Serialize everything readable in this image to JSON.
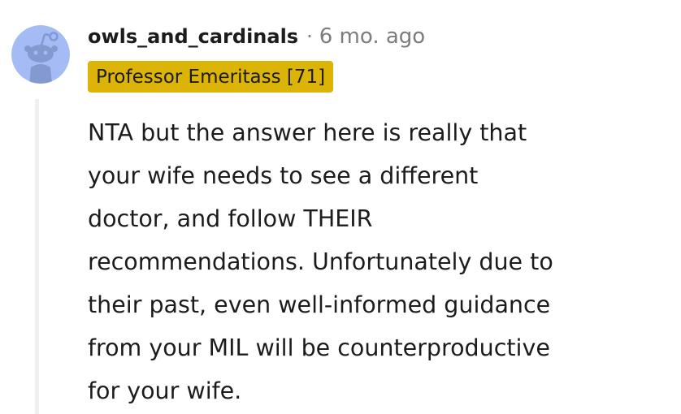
{
  "comment": {
    "author": "owls_and_cardinals",
    "separator": "·",
    "time": "6 mo. ago",
    "flair": "Professor Emeritass [71]",
    "body_lines": [
      "NTA but the answer here is really that",
      "your wife needs to see a different",
      "doctor, and follow THEIR",
      "recommendations. Unfortunately due to",
      "their past, even well-informed guidance",
      "from your MIL will be counterproductive",
      "for your wife."
    ]
  },
  "avatar": {
    "icon": "snoo-avatar-icon",
    "background_color": "#a5bbf5",
    "figure_color": "#8399cf"
  },
  "colors": {
    "flair_background": "#dcb407",
    "meta_text": "#7c7c7c",
    "thread_line": "#edeff1"
  }
}
